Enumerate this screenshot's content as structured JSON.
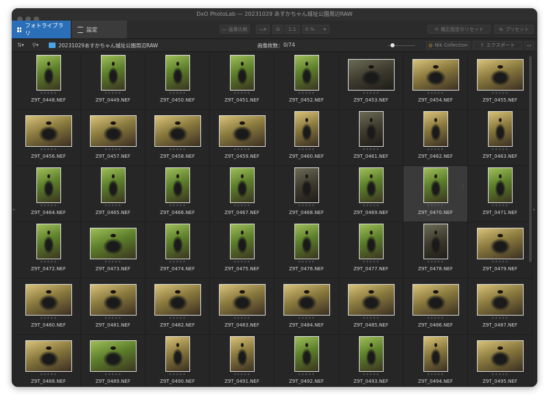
{
  "window_title": "DxO PhotoLab — 20231029 あすかちゃん城址公園周辺RAW",
  "tabs": [
    {
      "label": "フォトライブラリ",
      "icon": "grid-icon",
      "active": true
    },
    {
      "label": "設定",
      "icon": "sliders-icon",
      "active": false
    }
  ],
  "toolbar": {
    "compare_label": "画像比較",
    "zoom_label": "1:1",
    "zoom_value": "0 %",
    "reset_label": "補正設定のリセット",
    "preset_label": "プリセット"
  },
  "browser": {
    "folder_name": "20231029あすかちゃん城址公園周辺RAW",
    "image_count_label": "画像枚数：",
    "image_count_value": "0/74",
    "nik_label": "Nik Collection",
    "export_label": "エクスポート"
  },
  "colors": {
    "accent": "#2a6fb7",
    "background": "#262626"
  },
  "thumbnails": [
    {
      "name": "Z9T_0448.NEF",
      "orientation": "portrait",
      "tone": "green"
    },
    {
      "name": "Z9T_0449.NEF",
      "orientation": "portrait",
      "tone": "green"
    },
    {
      "name": "Z9T_0450.NEF",
      "orientation": "portrait",
      "tone": "green"
    },
    {
      "name": "Z9T_0451.NEF",
      "orientation": "portrait",
      "tone": "green"
    },
    {
      "name": "Z9T_0452.NEF",
      "orientation": "portrait",
      "tone": "green"
    },
    {
      "name": "Z9T_0453.NEF",
      "orientation": "landscape",
      "tone": "dark"
    },
    {
      "name": "Z9T_0454.NEF",
      "orientation": "landscape",
      "tone": "warm"
    },
    {
      "name": "Z9T_0455.NEF",
      "orientation": "landscape",
      "tone": "warm"
    },
    {
      "name": "Z9T_0456.NEF",
      "orientation": "landscape",
      "tone": "warm"
    },
    {
      "name": "Z9T_0457.NEF",
      "orientation": "landscape",
      "tone": "warm"
    },
    {
      "name": "Z9T_0458.NEF",
      "orientation": "landscape",
      "tone": "warm"
    },
    {
      "name": "Z9T_0459.NEF",
      "orientation": "landscape",
      "tone": "warm"
    },
    {
      "name": "Z9T_0460.NEF",
      "orientation": "portrait",
      "tone": "warm"
    },
    {
      "name": "Z9T_0461.NEF",
      "orientation": "portrait",
      "tone": "dark"
    },
    {
      "name": "Z9T_0462.NEF",
      "orientation": "portrait",
      "tone": "warm"
    },
    {
      "name": "Z9T_0463.NEF",
      "orientation": "portrait",
      "tone": "warm"
    },
    {
      "name": "Z9T_0464.NEF",
      "orientation": "portrait",
      "tone": "green"
    },
    {
      "name": "Z9T_0465.NEF",
      "orientation": "portrait",
      "tone": "green"
    },
    {
      "name": "Z9T_0466.NEF",
      "orientation": "portrait",
      "tone": "green"
    },
    {
      "name": "Z9T_0467.NEF",
      "orientation": "portrait",
      "tone": "green"
    },
    {
      "name": "Z9T_0468.NEF",
      "orientation": "portrait",
      "tone": "dark"
    },
    {
      "name": "Z9T_0469.NEF",
      "orientation": "portrait",
      "tone": "green"
    },
    {
      "name": "Z9T_0470.NEF",
      "orientation": "portrait",
      "tone": "green"
    },
    {
      "name": "Z9T_0471.NEF",
      "orientation": "portrait",
      "tone": "green"
    },
    {
      "name": "Z9T_0472.NEF",
      "orientation": "portrait",
      "tone": "green"
    },
    {
      "name": "Z9T_0473.NEF",
      "orientation": "landscape",
      "tone": "green"
    },
    {
      "name": "Z9T_0474.NEF",
      "orientation": "portrait",
      "tone": "green"
    },
    {
      "name": "Z9T_0475.NEF",
      "orientation": "portrait",
      "tone": "green"
    },
    {
      "name": "Z9T_0476.NEF",
      "orientation": "portrait",
      "tone": "green"
    },
    {
      "name": "Z9T_0477.NEF",
      "orientation": "portrait",
      "tone": "green"
    },
    {
      "name": "Z9T_0478.NEF",
      "orientation": "portrait",
      "tone": "dark"
    },
    {
      "name": "Z9T_0479.NEF",
      "orientation": "landscape",
      "tone": "warm"
    },
    {
      "name": "Z9T_0480.NEF",
      "orientation": "landscape",
      "tone": "warm"
    },
    {
      "name": "Z9T_0481.NEF",
      "orientation": "landscape",
      "tone": "warm"
    },
    {
      "name": "Z9T_0482.NEF",
      "orientation": "landscape",
      "tone": "warm"
    },
    {
      "name": "Z9T_0483.NEF",
      "orientation": "landscape",
      "tone": "warm"
    },
    {
      "name": "Z9T_0484.NEF",
      "orientation": "landscape",
      "tone": "warm"
    },
    {
      "name": "Z9T_0485.NEF",
      "orientation": "landscape",
      "tone": "warm"
    },
    {
      "name": "Z9T_0486.NEF",
      "orientation": "landscape",
      "tone": "warm"
    },
    {
      "name": "Z9T_0487.NEF",
      "orientation": "landscape",
      "tone": "warm"
    },
    {
      "name": "Z9T_0488.NEF",
      "orientation": "landscape",
      "tone": "warm"
    },
    {
      "name": "Z9T_0489.NEF",
      "orientation": "landscape",
      "tone": "green"
    },
    {
      "name": "Z9T_0490.NEF",
      "orientation": "portrait",
      "tone": "warm"
    },
    {
      "name": "Z9T_0491.NEF",
      "orientation": "portrait",
      "tone": "warm"
    },
    {
      "name": "Z9T_0492.NEF",
      "orientation": "portrait",
      "tone": "green"
    },
    {
      "name": "Z9T_0493.NEF",
      "orientation": "portrait",
      "tone": "green"
    },
    {
      "name": "Z9T_0494.NEF",
      "orientation": "portrait",
      "tone": "warm"
    },
    {
      "name": "Z9T_0495.NEF",
      "orientation": "landscape",
      "tone": "warm"
    }
  ],
  "selected_name": "Z9T_0470.NEF",
  "rating_glyphs": "★★★★★"
}
